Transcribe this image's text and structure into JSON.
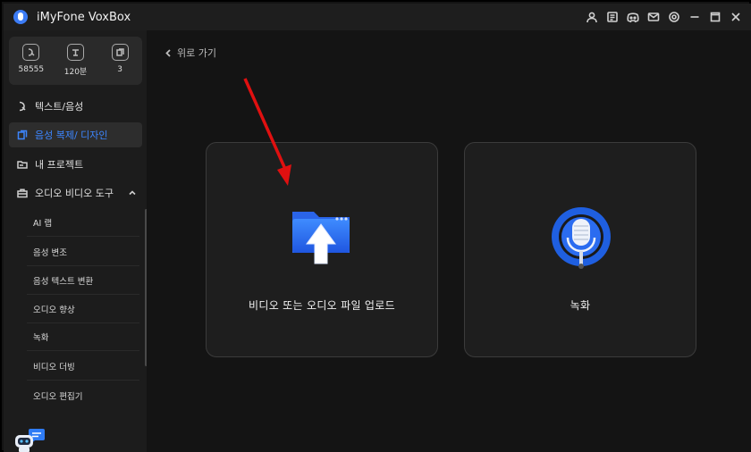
{
  "app": {
    "title": "iMyFone VoxBox"
  },
  "titlebar_icons": [
    "user-icon",
    "gift-icon",
    "discord-icon",
    "mail-icon",
    "settings-icon",
    "minimize-icon",
    "maximize-icon",
    "close-icon"
  ],
  "stats": [
    {
      "icon": "character-count-icon",
      "value": "58555"
    },
    {
      "icon": "duration-icon",
      "value": "120분"
    },
    {
      "icon": "clone-count-icon",
      "value": "3"
    }
  ],
  "sidebar": {
    "items": [
      {
        "label": "텍스트/음성",
        "icon": "tts-icon"
      },
      {
        "label": "음성 복제/ 디자인",
        "icon": "clone-icon",
        "active": true
      },
      {
        "label": "내 프로젝트",
        "icon": "folder-icon"
      },
      {
        "label": "오디오 비디오 도구",
        "icon": "toolbox-icon",
        "expanded": true
      }
    ],
    "sub_items": [
      "AI 랩",
      "음성 변조",
      "음성 텍스트 변환",
      "오디오 향상",
      "녹화",
      "비디오 더빙",
      "오디오 편집기"
    ]
  },
  "main": {
    "back_label": "위로 가기",
    "cards": [
      {
        "label": "비디오 또는 오디오 파일 업로드",
        "icon": "upload-folder-icon"
      },
      {
        "label": "녹화",
        "icon": "microphone-icon"
      }
    ]
  },
  "colors": {
    "accent": "#3d86ff",
    "annotation_arrow": "#e01010"
  }
}
